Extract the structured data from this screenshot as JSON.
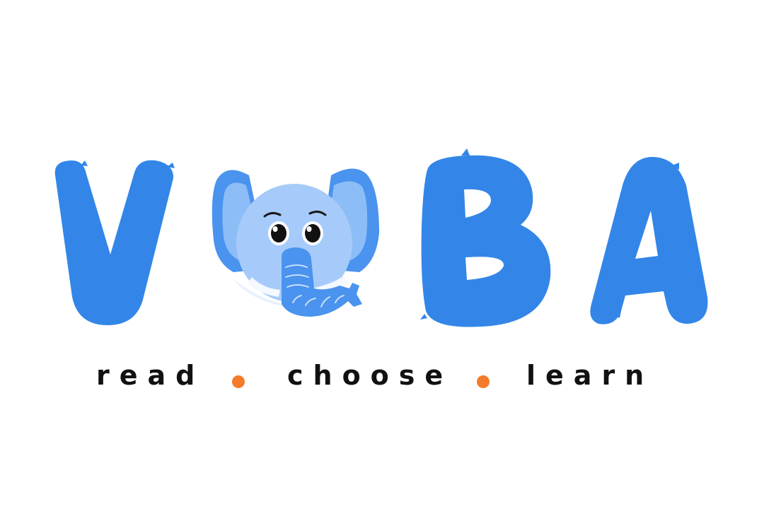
{
  "logo": {
    "wordmark": "VOBA",
    "letters": [
      "V",
      "B",
      "A"
    ],
    "mascot": "elephant-head"
  },
  "tagline": {
    "words": [
      "read",
      "choose",
      "learn"
    ],
    "separator": "dot"
  },
  "colors": {
    "brand_blue": "#3386E8",
    "elephant_ear_outer": "#4A93EE",
    "elephant_ear_inner": "#8DBDF7",
    "elephant_face": "#A6CBFA",
    "elephant_trunk": "#4A93EE",
    "tusk": "#F4F8FF",
    "dot_orange": "#F47B29",
    "text": "#111111",
    "background": "#FFFFFF"
  },
  "icons": [
    "elephant-icon",
    "separator-dot-icon"
  ]
}
